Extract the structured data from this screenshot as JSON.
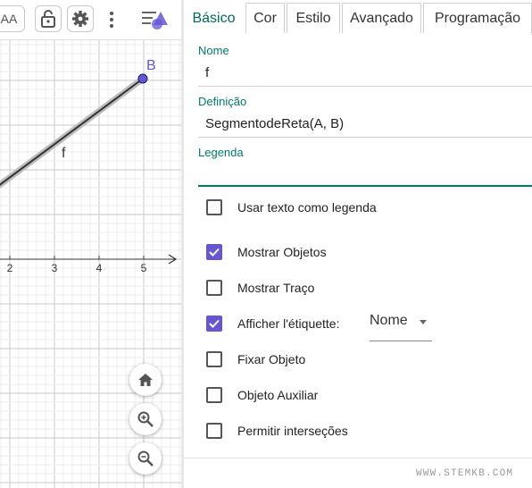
{
  "graphics": {
    "point_label": "B",
    "segment_label": "f",
    "x_ticks": [
      "2",
      "3",
      "4",
      "5"
    ],
    "toolbar": {
      "style_label": "AA",
      "lock_icon": "lock-icon",
      "settings_icon": "gear-icon",
      "more_icon": "more-vertical-icon",
      "menu_icon": "algebra-menu-icon"
    },
    "nav_buttons": [
      "home-icon",
      "zoom-in-icon",
      "zoom-out-icon"
    ],
    "colors": {
      "point": "#6557d2",
      "segment": "#333333",
      "grid": "#e0e0e0"
    }
  },
  "props": {
    "tabs": [
      {
        "label": "Básico",
        "active": true
      },
      {
        "label": "Cor",
        "active": false
      },
      {
        "label": "Estilo",
        "active": false
      },
      {
        "label": "Avançado",
        "active": false
      },
      {
        "label": "Programação",
        "active": false
      }
    ],
    "name": {
      "label": "Nome",
      "value": "f"
    },
    "definition": {
      "label": "Definição",
      "value": "SegmentodeReta(A, B)"
    },
    "caption": {
      "label": "Legenda",
      "value": ""
    },
    "checkboxes": [
      {
        "label": "Usar texto como legenda",
        "checked": false
      },
      {
        "label": "Mostrar Objetos",
        "checked": true
      },
      {
        "label": "Mostrar Traço",
        "checked": false
      },
      {
        "label": "Afficher l'étiquette:",
        "checked": true
      },
      {
        "label": "Fixar Objeto",
        "checked": false
      },
      {
        "label": "Objeto Auxiliar",
        "checked": false
      },
      {
        "label": "Permitir interseções",
        "checked": false
      }
    ],
    "label_dropdown": {
      "value": "Nome"
    },
    "watermark": "WWW.STEMKB.COM",
    "accent_color": "#00796b",
    "checkbox_color": "#6557d2"
  }
}
